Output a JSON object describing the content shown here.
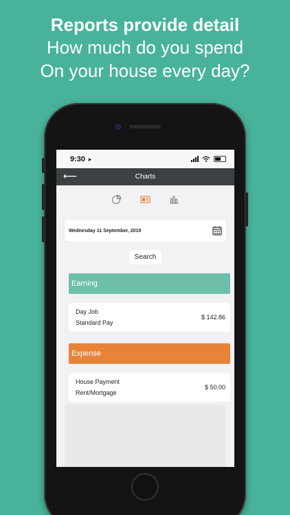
{
  "promo": {
    "headline": "Reports provide detail",
    "line2": "How much do you spend",
    "line3": "On your house every day?"
  },
  "status_bar": {
    "time": "9:30"
  },
  "header": {
    "title": "Charts"
  },
  "tabs": [
    {
      "icon": "pie-chart-icon",
      "active": false
    },
    {
      "icon": "report-icon",
      "active": true
    },
    {
      "icon": "bar-chart-icon",
      "active": false
    }
  ],
  "date_picker": {
    "value": "Wednesday 11 September, 2019"
  },
  "search_label": "Search",
  "earning": {
    "label": "Earning",
    "color": "#6dbfa9",
    "item": {
      "name": "Day Job",
      "category": "Standard Pay",
      "amount": "$ 142.86"
    }
  },
  "expense": {
    "label": "Expense",
    "color": "#e8843a",
    "item": {
      "name": "House Payment",
      "category": "Rent/Mortgage",
      "amount": "$ 50.00"
    }
  },
  "colors": {
    "background": "#48b39a",
    "accent_active_tab": "#e8843a",
    "nav_bar": "#3d4144"
  }
}
